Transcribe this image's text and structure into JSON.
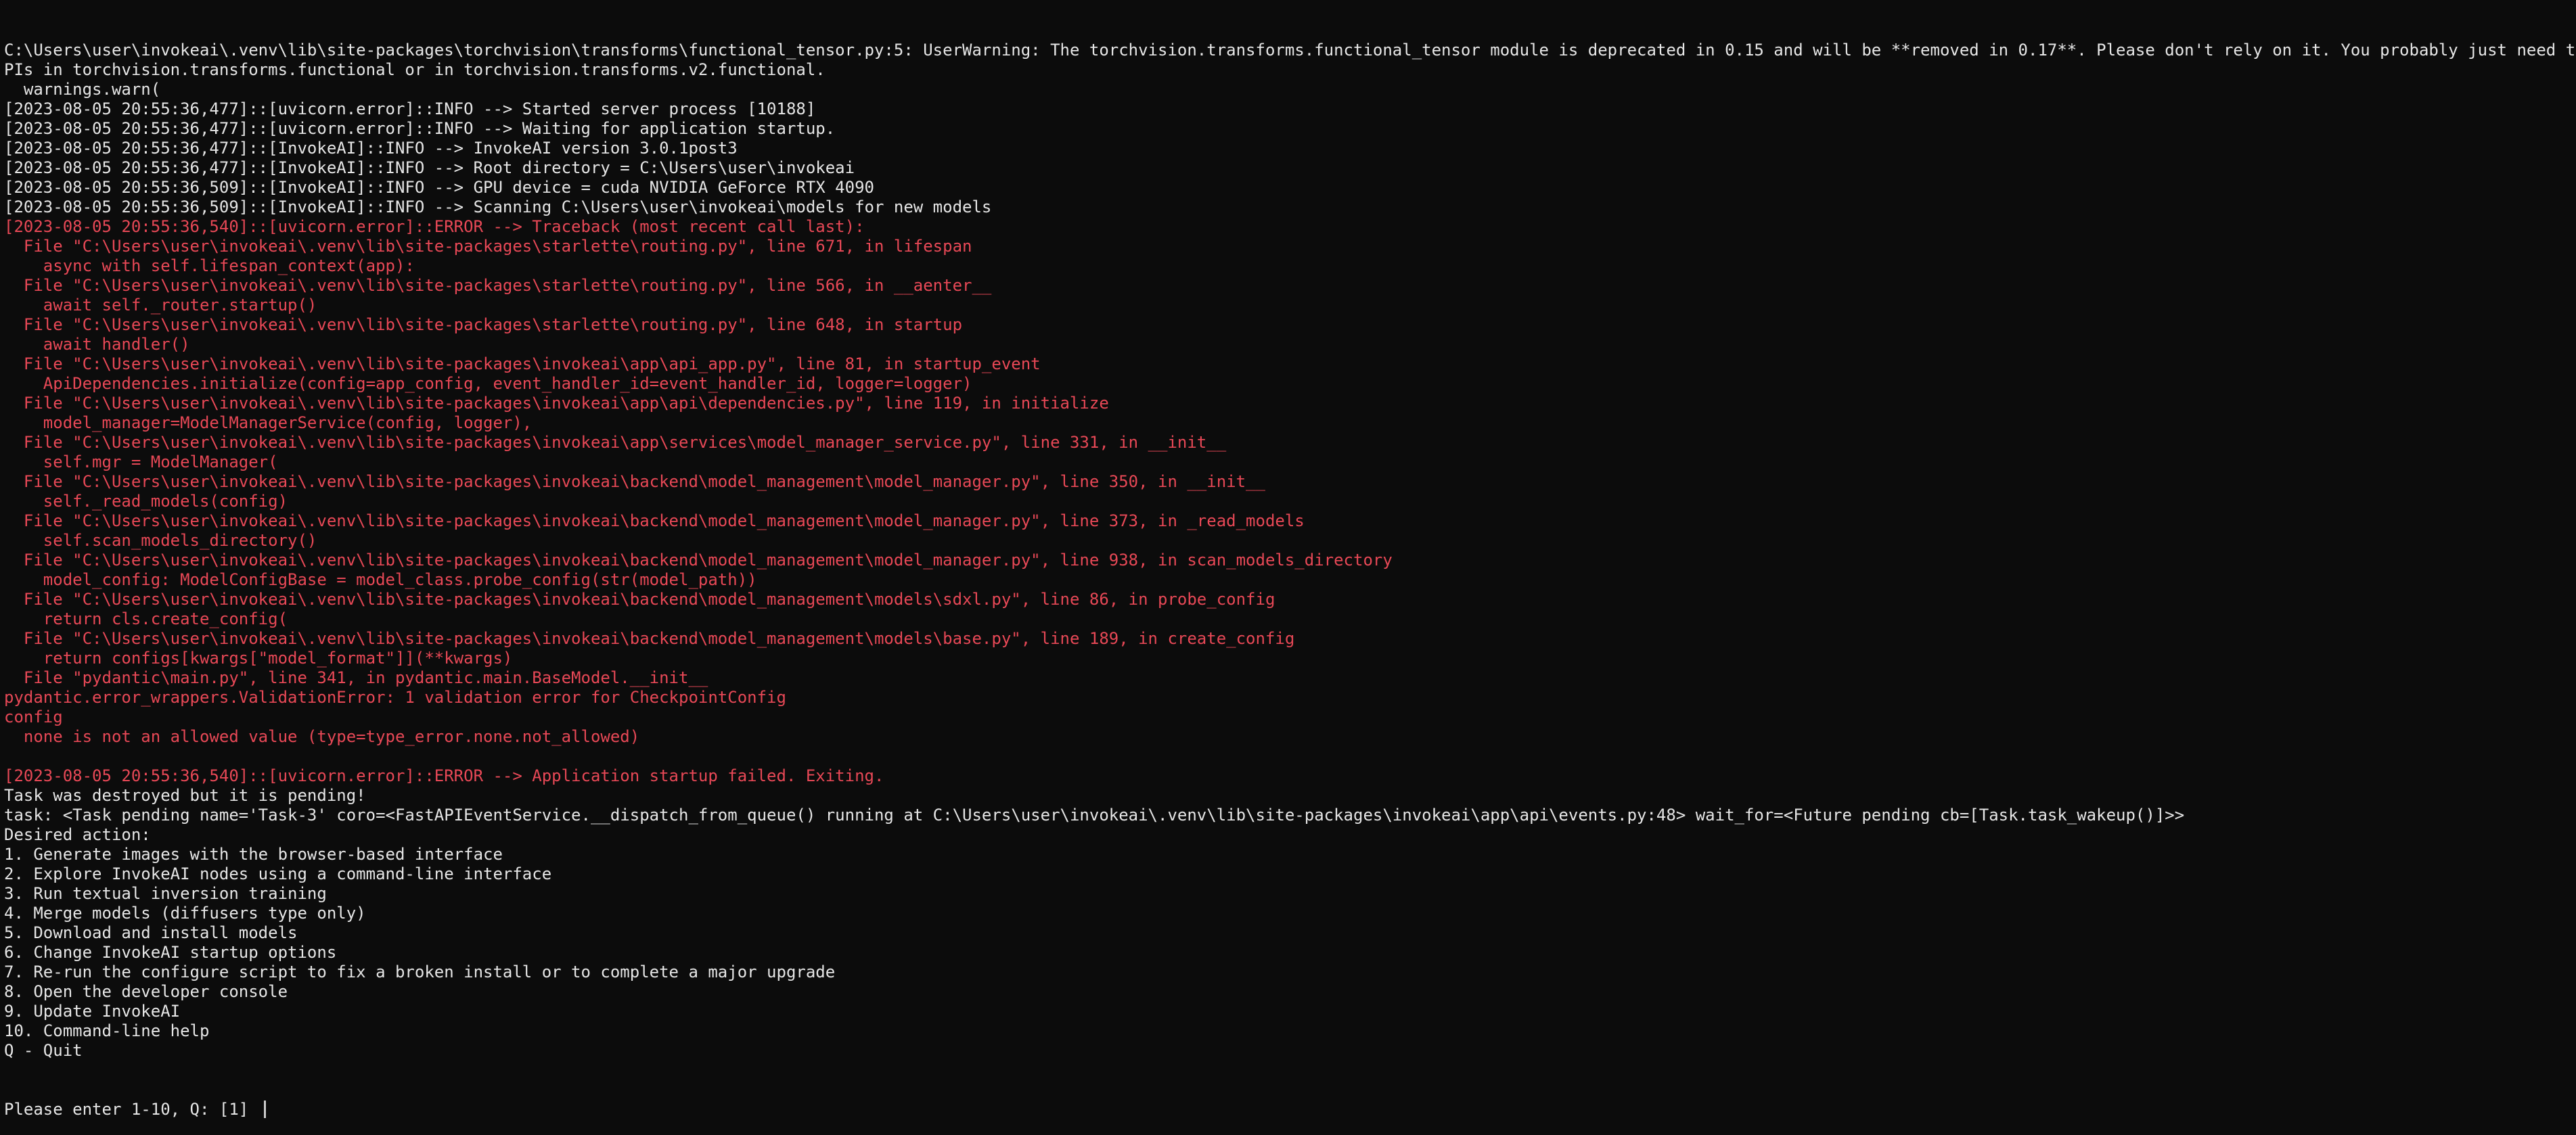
{
  "colors": {
    "background": "#0c0c0c",
    "text": "#cccccc",
    "error": "#e74856"
  },
  "terminal": {
    "lines": [
      {
        "style": "bright",
        "text": "C:\\Users\\user\\invokeai\\.venv\\lib\\site-packages\\torchvision\\transforms\\functional_tensor.py:5: UserWarning: The torchvision.transforms.functional_tensor module is deprecated in 0.15 and will be **removed in 0.17**. Please don't rely on it. You probably just need to use A"
      },
      {
        "style": "bright",
        "text": "PIs in torchvision.transforms.functional or in torchvision.transforms.v2.functional."
      },
      {
        "style": "bright",
        "text": "  warnings.warn("
      },
      {
        "style": "bright",
        "text": "[2023-08-05 20:55:36,477]::[uvicorn.error]::INFO --> Started server process [10188]"
      },
      {
        "style": "bright",
        "text": "[2023-08-05 20:55:36,477]::[uvicorn.error]::INFO --> Waiting for application startup."
      },
      {
        "style": "bright",
        "text": "[2023-08-05 20:55:36,477]::[InvokeAI]::INFO --> InvokeAI version 3.0.1post3"
      },
      {
        "style": "bright",
        "text": "[2023-08-05 20:55:36,477]::[InvokeAI]::INFO --> Root directory = C:\\Users\\user\\invokeai"
      },
      {
        "style": "bright",
        "text": "[2023-08-05 20:55:36,509]::[InvokeAI]::INFO --> GPU device = cuda NVIDIA GeForce RTX 4090"
      },
      {
        "style": "bright",
        "text": "[2023-08-05 20:55:36,509]::[InvokeAI]::INFO --> Scanning C:\\Users\\user\\invokeai\\models for new models"
      },
      {
        "style": "error",
        "text": "[2023-08-05 20:55:36,540]::[uvicorn.error]::ERROR --> Traceback (most recent call last):"
      },
      {
        "style": "error",
        "text": "  File \"C:\\Users\\user\\invokeai\\.venv\\lib\\site-packages\\starlette\\routing.py\", line 671, in lifespan"
      },
      {
        "style": "error",
        "text": "    async with self.lifespan_context(app):"
      },
      {
        "style": "error",
        "text": "  File \"C:\\Users\\user\\invokeai\\.venv\\lib\\site-packages\\starlette\\routing.py\", line 566, in __aenter__"
      },
      {
        "style": "error",
        "text": "    await self._router.startup()"
      },
      {
        "style": "error",
        "text": "  File \"C:\\Users\\user\\invokeai\\.venv\\lib\\site-packages\\starlette\\routing.py\", line 648, in startup"
      },
      {
        "style": "error",
        "text": "    await handler()"
      },
      {
        "style": "error",
        "text": "  File \"C:\\Users\\user\\invokeai\\.venv\\lib\\site-packages\\invokeai\\app\\api_app.py\", line 81, in startup_event"
      },
      {
        "style": "error",
        "text": "    ApiDependencies.initialize(config=app_config, event_handler_id=event_handler_id, logger=logger)"
      },
      {
        "style": "error",
        "text": "  File \"C:\\Users\\user\\invokeai\\.venv\\lib\\site-packages\\invokeai\\app\\api\\dependencies.py\", line 119, in initialize"
      },
      {
        "style": "error",
        "text": "    model_manager=ModelManagerService(config, logger),"
      },
      {
        "style": "error",
        "text": "  File \"C:\\Users\\user\\invokeai\\.venv\\lib\\site-packages\\invokeai\\app\\services\\model_manager_service.py\", line 331, in __init__"
      },
      {
        "style": "error",
        "text": "    self.mgr = ModelManager("
      },
      {
        "style": "error",
        "text": "  File \"C:\\Users\\user\\invokeai\\.venv\\lib\\site-packages\\invokeai\\backend\\model_management\\model_manager.py\", line 350, in __init__"
      },
      {
        "style": "error",
        "text": "    self._read_models(config)"
      },
      {
        "style": "error",
        "text": "  File \"C:\\Users\\user\\invokeai\\.venv\\lib\\site-packages\\invokeai\\backend\\model_management\\model_manager.py\", line 373, in _read_models"
      },
      {
        "style": "error",
        "text": "    self.scan_models_directory()"
      },
      {
        "style": "error",
        "text": "  File \"C:\\Users\\user\\invokeai\\.venv\\lib\\site-packages\\invokeai\\backend\\model_management\\model_manager.py\", line 938, in scan_models_directory"
      },
      {
        "style": "error",
        "text": "    model_config: ModelConfigBase = model_class.probe_config(str(model_path))"
      },
      {
        "style": "error",
        "text": "  File \"C:\\Users\\user\\invokeai\\.venv\\lib\\site-packages\\invokeai\\backend\\model_management\\models\\sdxl.py\", line 86, in probe_config"
      },
      {
        "style": "error",
        "text": "    return cls.create_config("
      },
      {
        "style": "error",
        "text": "  File \"C:\\Users\\user\\invokeai\\.venv\\lib\\site-packages\\invokeai\\backend\\model_management\\models\\base.py\", line 189, in create_config"
      },
      {
        "style": "error",
        "text": "    return configs[kwargs[\"model_format\"]](**kwargs)"
      },
      {
        "style": "error",
        "text": "  File \"pydantic\\main.py\", line 341, in pydantic.main.BaseModel.__init__"
      },
      {
        "style": "error",
        "text": "pydantic.error_wrappers.ValidationError: 1 validation error for CheckpointConfig"
      },
      {
        "style": "error",
        "text": "config"
      },
      {
        "style": "error",
        "text": "  none is not an allowed value (type=type_error.none.not_allowed)"
      },
      {
        "style": "blank",
        "text": ""
      },
      {
        "style": "error",
        "text": "[2023-08-05 20:55:36,540]::[uvicorn.error]::ERROR --> Application startup failed. Exiting."
      },
      {
        "style": "bright",
        "text": "Task was destroyed but it is pending!"
      },
      {
        "style": "bright",
        "text": "task: <Task pending name='Task-3' coro=<FastAPIEventService.__dispatch_from_queue() running at C:\\Users\\user\\invokeai\\.venv\\lib\\site-packages\\invokeai\\app\\api\\events.py:48> wait_for=<Future pending cb=[Task.task_wakeup()]>>"
      },
      {
        "style": "bright",
        "text": "Desired action:"
      },
      {
        "style": "bright",
        "text": "1. Generate images with the browser-based interface"
      },
      {
        "style": "bright",
        "text": "2. Explore InvokeAI nodes using a command-line interface"
      },
      {
        "style": "bright",
        "text": "3. Run textual inversion training"
      },
      {
        "style": "bright",
        "text": "4. Merge models (diffusers type only)"
      },
      {
        "style": "bright",
        "text": "5. Download and install models"
      },
      {
        "style": "bright",
        "text": "6. Change InvokeAI startup options"
      },
      {
        "style": "bright",
        "text": "7. Re-run the configure script to fix a broken install or to complete a major upgrade"
      },
      {
        "style": "bright",
        "text": "8. Open the developer console"
      },
      {
        "style": "bright",
        "text": "9. Update InvokeAI"
      },
      {
        "style": "bright",
        "text": "10. Command-line help"
      },
      {
        "style": "bright",
        "text": "Q - Quit"
      }
    ],
    "prompt": "Please enter 1-10, Q: [1] "
  }
}
